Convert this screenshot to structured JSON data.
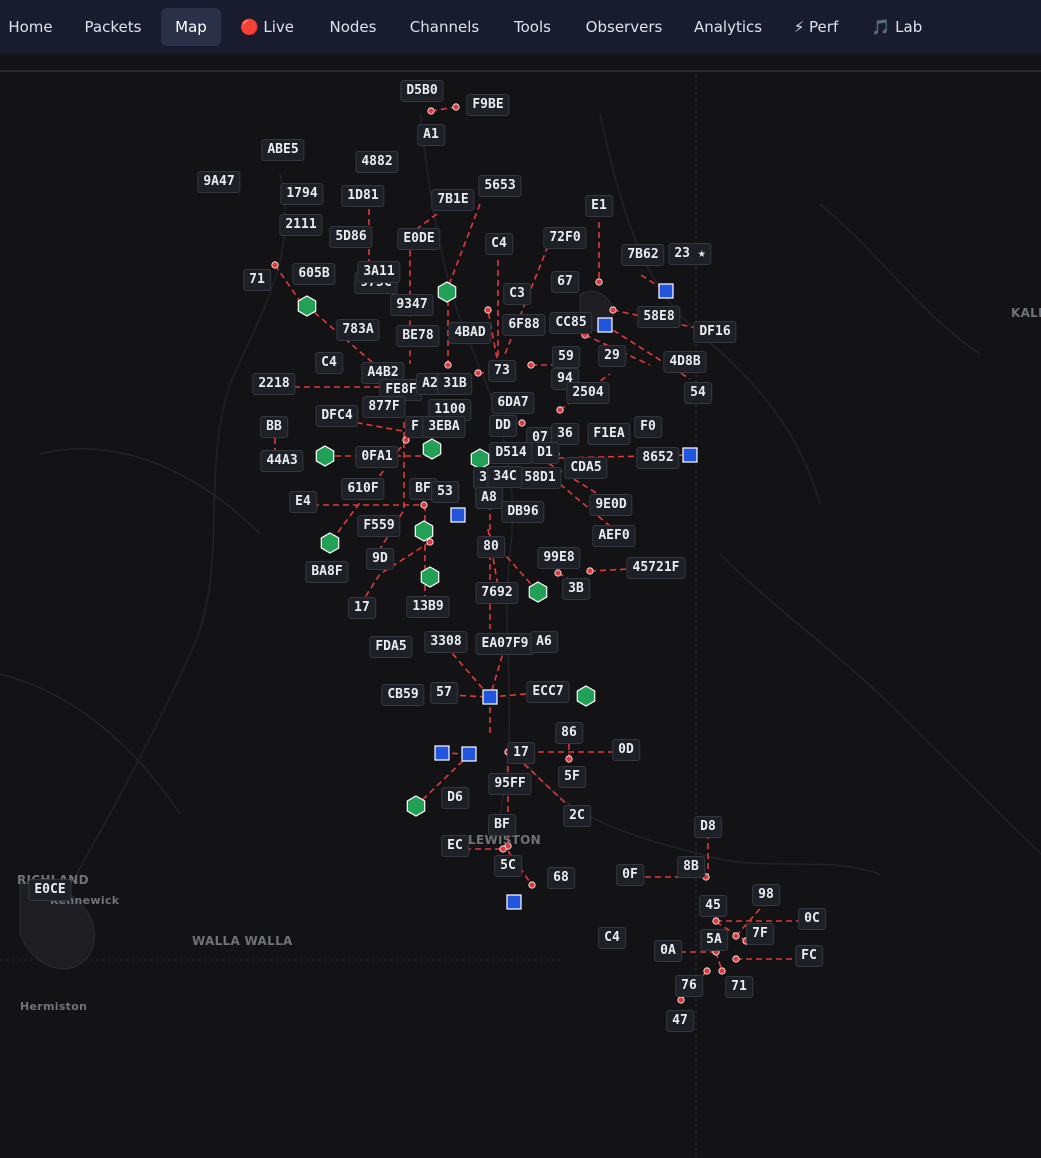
{
  "nav": {
    "items": [
      {
        "label": "Home"
      },
      {
        "label": "Packets"
      },
      {
        "label": "Map",
        "active": true
      },
      {
        "label": "🔴 Live"
      },
      {
        "label": "Nodes"
      },
      {
        "label": "Channels"
      },
      {
        "label": "Tools"
      },
      {
        "label": "Observers"
      },
      {
        "label": "Analytics"
      },
      {
        "label": "⚡ Perf"
      },
      {
        "label": "🎵 Lab"
      }
    ]
  },
  "map": {
    "places": [
      "RICHLAND",
      "Kennewick",
      "WALLA WALLA",
      "Hermiston",
      "LEWISTON",
      "KALIS"
    ],
    "colors": {
      "link": "#e0393c",
      "repeater": "#2255dd",
      "companion": "#22a055",
      "point": "#e0393c",
      "background": "#131315",
      "label_bg": "#1d2026"
    },
    "node_labels": [
      "D5B0",
      "F9BE",
      "A1",
      "ABE5",
      "4882",
      "9A47",
      "1794",
      "1D81",
      "7B1E",
      "5653",
      "E1",
      "2111",
      "5D86",
      "E0DE",
      "C4",
      "72F0",
      "7B62",
      "23 ★",
      "71",
      "605B",
      "975C",
      "3A11",
      "67",
      "C3",
      "9347",
      "58E8",
      "CC85",
      "DF16",
      "783A",
      "BE78",
      "4BAD",
      "6F88",
      "C4",
      "A4B2",
      "59",
      "29",
      "4D8B",
      "2218",
      "FE8F",
      "A2",
      "31B",
      "73",
      "94",
      "2504",
      "54",
      "877F",
      "6DA7",
      "DFC4",
      "1100",
      "F",
      "3EBA",
      "DD",
      "BB",
      "07",
      "36",
      "F1EA",
      "F0",
      "44A3",
      "0FA1",
      "D514",
      "D1",
      "8652",
      "CDA5",
      "3",
      "58D1",
      "610F",
      "BF",
      "53",
      "34C",
      "A8",
      "E4",
      "DB96",
      "9E0D",
      "F559",
      "AEF0",
      "9D",
      "80",
      "99E8",
      "45721F",
      "BA8F",
      "3B",
      "7692",
      "17",
      "13B9",
      "FDA5",
      "3308",
      "EA07F9",
      "A6",
      "CB59",
      "57",
      "ECC7",
      "86",
      "0D",
      "17",
      "5F",
      "95FF",
      "D6",
      "2C",
      "D8",
      "BF",
      "EC",
      "5C",
      "8B",
      "0F",
      "68",
      "E0CE",
      "98",
      "45",
      "0C",
      "7F",
      "5A",
      "C4",
      "0A",
      "FC",
      "76",
      "71",
      "47"
    ],
    "repeater_count": 11,
    "companion_count": 14
  }
}
